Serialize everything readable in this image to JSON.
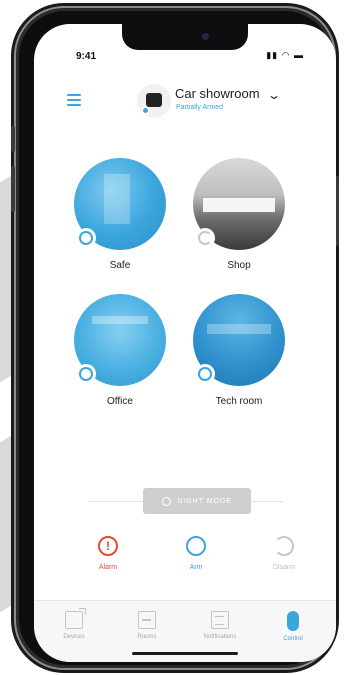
{
  "status_bar": {
    "time": "9:41",
    "icons": "signal-wifi-battery"
  },
  "header": {
    "menu_icon": "hamburger-icon",
    "site_name": "Car showroom",
    "site_status": "Partially Armed"
  },
  "groups": [
    {
      "label": "Safe",
      "state": "armed"
    },
    {
      "label": "Shop",
      "state": "loading"
    },
    {
      "label": "Office",
      "state": "armed"
    },
    {
      "label": "Tech room",
      "state": "armed"
    }
  ],
  "night_mode": {
    "label": "NIGHT MODE"
  },
  "controls": {
    "alarm": {
      "label": "Alarm",
      "color": "#e8492f"
    },
    "arm": {
      "label": "Arm",
      "color": "#3ba6dc"
    },
    "disarm": {
      "label": "Disarm",
      "color": "#bdbdbd"
    }
  },
  "tabs": [
    {
      "label": "Devices",
      "icon": "devices-icon",
      "active": false
    },
    {
      "label": "Rooms",
      "icon": "rooms-icon",
      "active": false
    },
    {
      "label": "Notifications",
      "icon": "notifications-icon",
      "active": false
    },
    {
      "label": "Control",
      "icon": "control-icon",
      "active": true
    }
  ],
  "colors": {
    "accent": "#3ba6dc",
    "alarm": "#e8492f",
    "inactive": "#c4c4c4"
  }
}
